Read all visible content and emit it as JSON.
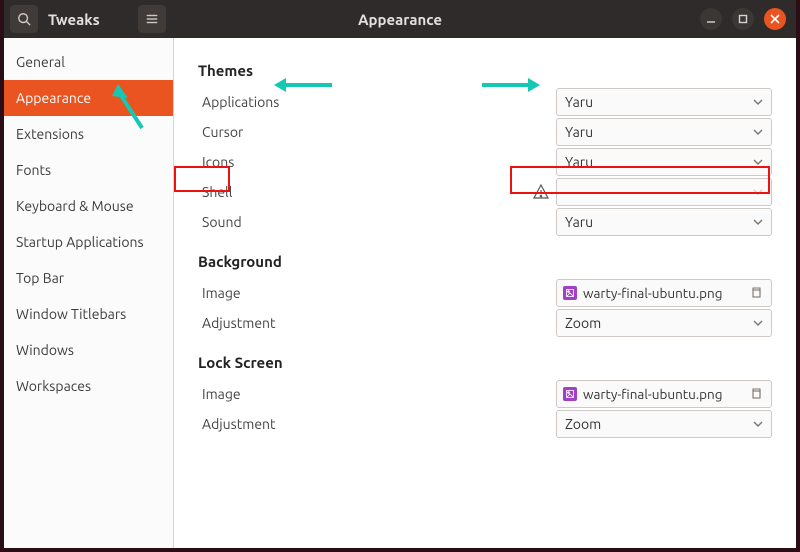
{
  "window": {
    "app_title": "Tweaks",
    "page_title": "Appearance"
  },
  "sidebar": {
    "items": [
      {
        "label": "General"
      },
      {
        "label": "Appearance"
      },
      {
        "label": "Extensions"
      },
      {
        "label": "Fonts"
      },
      {
        "label": "Keyboard & Mouse"
      },
      {
        "label": "Startup Applications"
      },
      {
        "label": "Top Bar"
      },
      {
        "label": "Window Titlebars"
      },
      {
        "label": "Windows"
      },
      {
        "label": "Workspaces"
      }
    ],
    "active_index": 1
  },
  "sections": {
    "themes": {
      "heading": "Themes",
      "applications": {
        "label": "Applications",
        "value": "Yaru"
      },
      "cursor": {
        "label": "Cursor",
        "value": "Yaru"
      },
      "icons": {
        "label": "Icons",
        "value": "Yaru"
      },
      "shell": {
        "label": "Shell",
        "value": "",
        "disabled": true,
        "warning": true
      },
      "sound": {
        "label": "Sound",
        "value": "Yaru"
      }
    },
    "background": {
      "heading": "Background",
      "image": {
        "label": "Image",
        "filename": "warty-final-ubuntu.png"
      },
      "adjustment": {
        "label": "Adjustment",
        "value": "Zoom"
      }
    },
    "lockscreen": {
      "heading": "Lock Screen",
      "image": {
        "label": "Image",
        "filename": "warty-final-ubuntu.png"
      },
      "adjustment": {
        "label": "Adjustment",
        "value": "Zoom"
      }
    }
  },
  "colors": {
    "accent": "#e95420",
    "teal_arrow": "#14c8b4",
    "red_box": "#e11"
  }
}
